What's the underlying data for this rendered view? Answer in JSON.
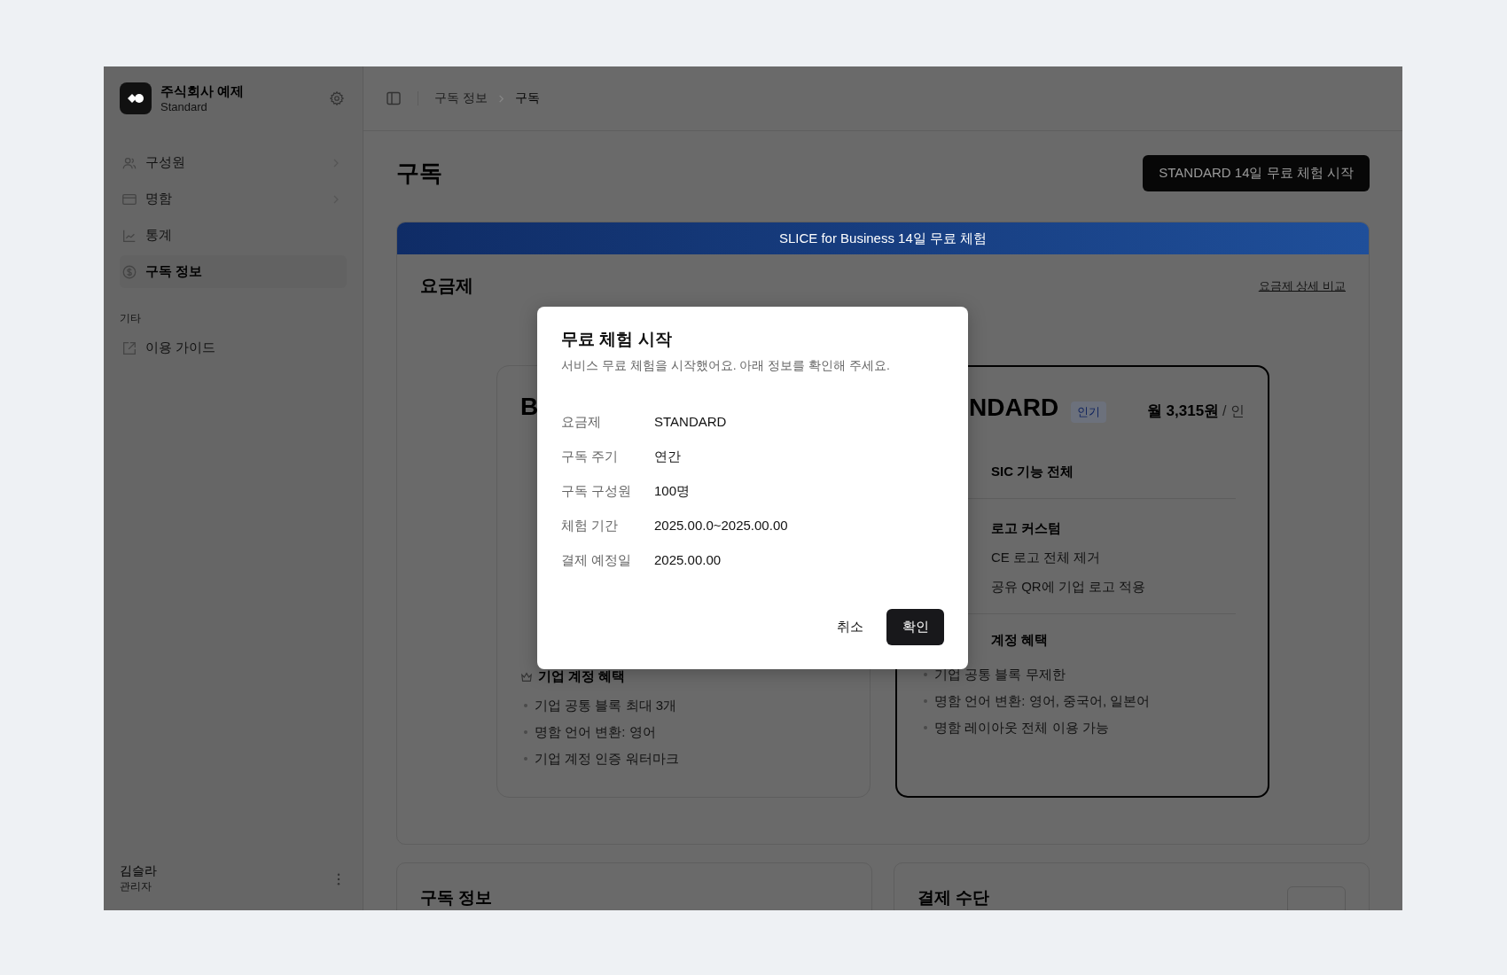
{
  "sidebar": {
    "org_name": "주식회사 예제",
    "org_plan": "Standard",
    "items": [
      {
        "label": "구성원",
        "expandable": true,
        "selected": false
      },
      {
        "label": "명함",
        "expandable": true,
        "selected": false
      },
      {
        "label": "통계",
        "expandable": false,
        "selected": false
      },
      {
        "label": "구독 정보",
        "expandable": false,
        "selected": true
      }
    ],
    "section_title": "기타",
    "extra_items": [
      {
        "label": "이용 가이드"
      }
    ],
    "user": {
      "name": "김슬라",
      "role": "관리자"
    }
  },
  "breadcrumb": [
    "구독 정보",
    "구독"
  ],
  "page": {
    "title": "구독",
    "trial_button": "STANDARD 14일 무료 체험 시작"
  },
  "banner": "SLICE for Business 14일 무료 체험",
  "plans": {
    "title": "요금제",
    "compare_link": "요금제 상세 비교",
    "cards": [
      {
        "title": "B",
        "highlighted": false,
        "sections": [
          {
            "heading": "기업 계정 혜택",
            "items": [
              "기업 공통 블록 최대 3개",
              "명함 언어 변환: 영어",
              "기업 계정 인증 워터마크"
            ]
          }
        ]
      },
      {
        "title": "NDARD",
        "highlighted": true,
        "badge": "인기",
        "price": "월 3,315원",
        "price_unit": "/ 인",
        "top_sections": [
          {
            "heading": "SIC 기능 전체"
          },
          {
            "heading": "로고 커스텀",
            "items": [
              "CE 로고 전체 제거",
              "공유 QR에 기업 로고 적용"
            ]
          }
        ],
        "sections": [
          {
            "heading": "계정 혜택",
            "items": [
              "기업 공통 블록 무제한",
              "명함 언어 변환: 영어, 중국어, 일본어",
              "명함 레이아웃 전체 이용 가능"
            ]
          }
        ]
      }
    ]
  },
  "bottom_cards": [
    {
      "title": "구독 정보"
    },
    {
      "title": "결제 수단"
    }
  ],
  "dialog": {
    "title": "무료 체험 시작",
    "description": "서비스 무료 체험을 시작했어요. 아래 정보를 확인해 주세요.",
    "fields": [
      {
        "label": "요금제",
        "value": "STANDARD"
      },
      {
        "label": "구독 주기",
        "value": "연간"
      },
      {
        "label": "구독 구성원",
        "value": "100명"
      },
      {
        "label": "체험 기간",
        "value": "2025.00.0~2025.00.00"
      },
      {
        "label": "결제 예정일",
        "value": "2025.00.00"
      }
    ],
    "cancel": "취소",
    "confirm": "확인"
  }
}
